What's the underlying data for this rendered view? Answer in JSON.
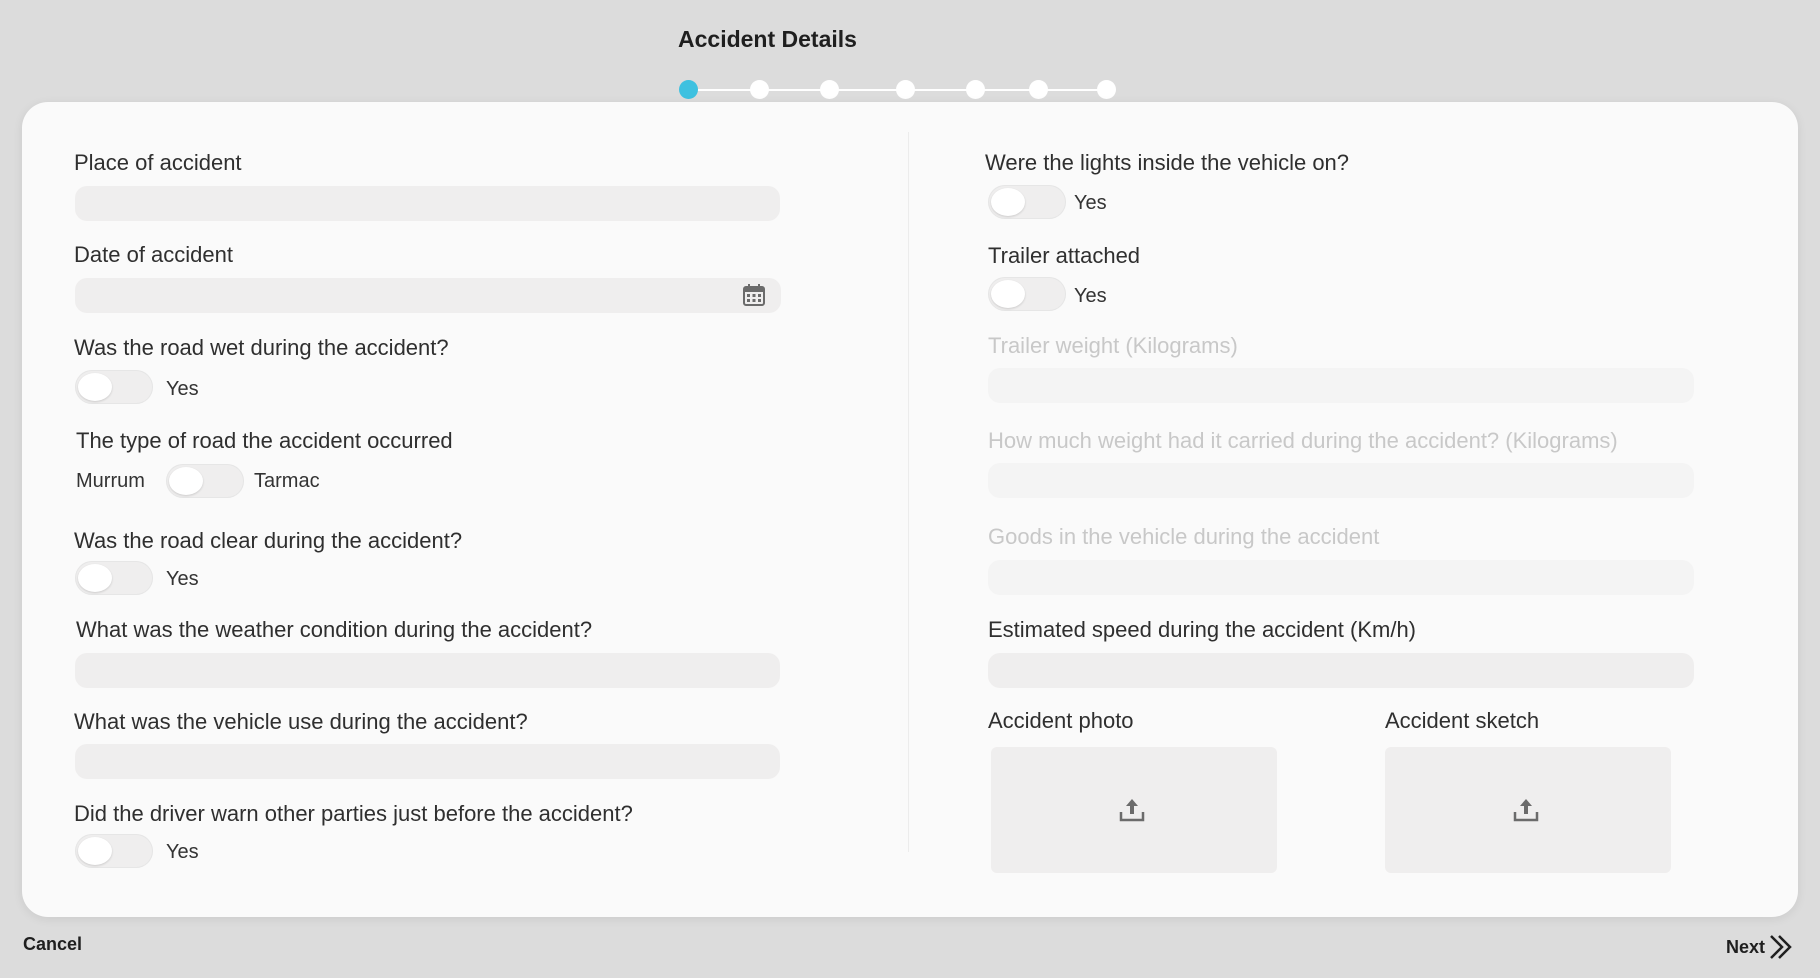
{
  "stepper": {
    "title": "Accident Details",
    "total_steps": 7,
    "active_step": 1
  },
  "left": {
    "place": {
      "label": "Place of accident",
      "value": ""
    },
    "date": {
      "label": "Date of accident",
      "value": "",
      "icon": "calendar-icon"
    },
    "road_wet": {
      "label": "Was the road wet during the accident?",
      "option": "Yes",
      "checked": false
    },
    "road_type": {
      "label": "The type of road the accident occurred",
      "left_option": "Murrum",
      "right_option": "Tarmac",
      "checked": false
    },
    "road_clear": {
      "label": "Was the road clear during the accident?",
      "option": "Yes",
      "checked": false
    },
    "weather": {
      "label": "What was the weather condition during the accident?",
      "value": ""
    },
    "vehicle_use": {
      "label": "What was the vehicle use during the accident?",
      "value": ""
    },
    "driver_warn": {
      "label": "Did the driver warn other parties just before the accident?",
      "option": "Yes",
      "checked": false
    }
  },
  "right": {
    "lights": {
      "label": "Were the lights inside the vehicle on?",
      "option": "Yes",
      "checked": false
    },
    "trailer": {
      "label": "Trailer attached",
      "option": "Yes",
      "checked": false
    },
    "trailer_weight": {
      "label": "Trailer weight (Kilograms)",
      "value": "",
      "disabled": true
    },
    "carried_weight": {
      "label": "How much weight had it carried during the accident? (Kilograms)",
      "value": "",
      "disabled": true
    },
    "goods": {
      "label": "Goods in the vehicle during the accident",
      "value": "",
      "disabled": true
    },
    "speed": {
      "label": "Estimated speed during the accident (Km/h)",
      "value": ""
    },
    "photo": {
      "label": "Accident photo",
      "icon": "upload-icon"
    },
    "sketch": {
      "label": "Accident sketch",
      "icon": "upload-icon"
    }
  },
  "footer": {
    "cancel": "Cancel",
    "next": "Next",
    "next_icon": "double-chevron-right-icon"
  },
  "colors": {
    "background": "#dcdcdc",
    "card": "#fafafa",
    "active_step": "#3ec1e0",
    "input": "#efeeee"
  }
}
